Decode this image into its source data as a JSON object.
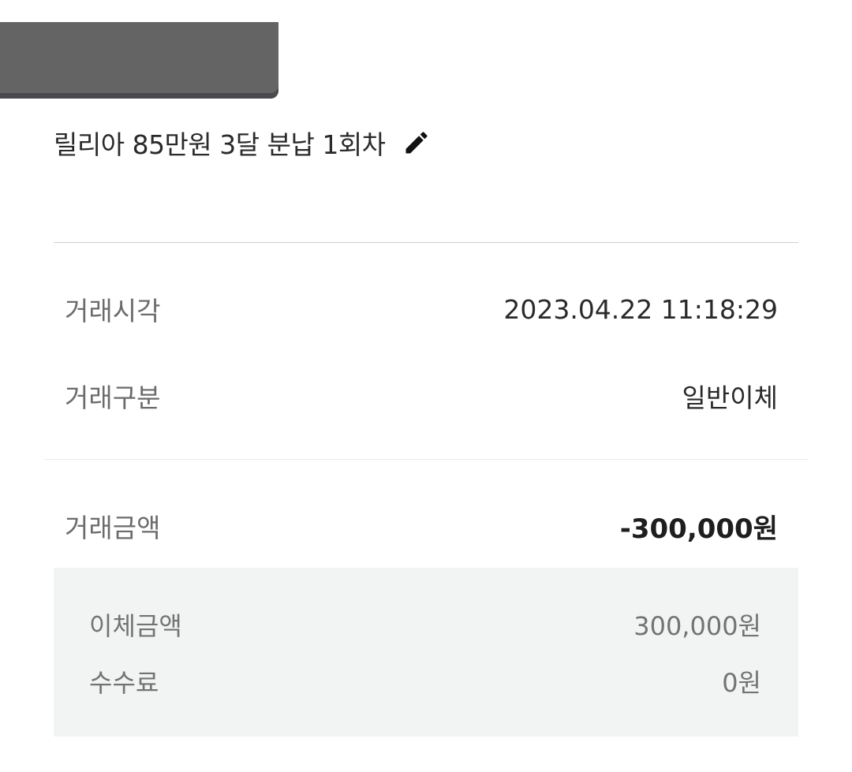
{
  "memo": {
    "text": "릴리아 85만원 3달 분납 1회차",
    "edit_icon": "pencil-icon"
  },
  "details": {
    "time_label": "거래시각",
    "time_value": "2023.04.22 11:18:29",
    "type_label": "거래구분",
    "type_value": "일반이체",
    "amount_label": "거래금액",
    "amount_value": "-300,000원"
  },
  "breakdown": {
    "transfer_label": "이체금액",
    "transfer_value": "300,000원",
    "fee_label": "수수료",
    "fee_value": "0원"
  },
  "colors": {
    "redaction": "#646464",
    "breakdown_background": "#f2f4f3"
  }
}
